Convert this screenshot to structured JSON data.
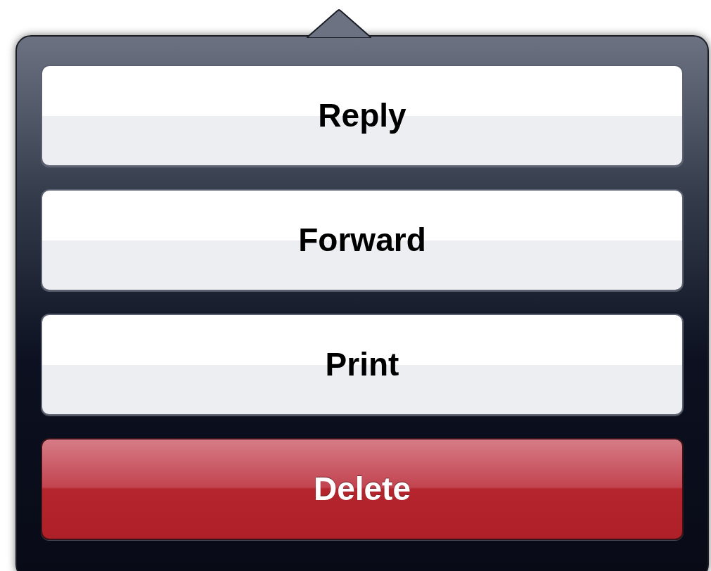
{
  "actions": [
    {
      "label": "Reply",
      "kind": "default"
    },
    {
      "label": "Forward",
      "kind": "default"
    },
    {
      "label": "Print",
      "kind": "default"
    },
    {
      "label": "Delete",
      "kind": "destructive"
    }
  ]
}
